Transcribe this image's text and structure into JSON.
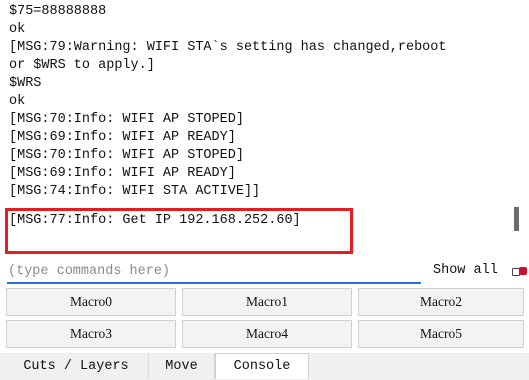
{
  "console": {
    "lines": [
      "$75=88888888",
      "ok",
      "[MSG:79:Warning: WIFI STA`s setting has changed,reboot",
      "or $WRS to apply.]",
      "$WRS",
      "ok",
      "[MSG:70:Info: WIFI AP STOPED]",
      "[MSG:69:Info: WIFI AP READY]",
      "[MSG:70:Info: WIFI AP STOPED]",
      "[MSG:69:Info: WIFI AP READY]",
      "[MSG:74:Info: WIFI STA ACTIVE]]",
      "[MSG:77:Info: Get IP 192.168.252.60]"
    ]
  },
  "command": {
    "placeholder": "(type commands here)",
    "show_all_label": "Show all"
  },
  "macros": [
    "Macro0",
    "Macro1",
    "Macro2",
    "Macro3",
    "Macro4",
    "Macro5"
  ],
  "tabs": {
    "cuts_layers": "Cuts / Layers",
    "move": "Move",
    "console": "Console",
    "active": "Console"
  },
  "colors": {
    "highlight": "#e02020",
    "input_underline": "#2a6fd6",
    "toggle_on": "#c8102e"
  }
}
